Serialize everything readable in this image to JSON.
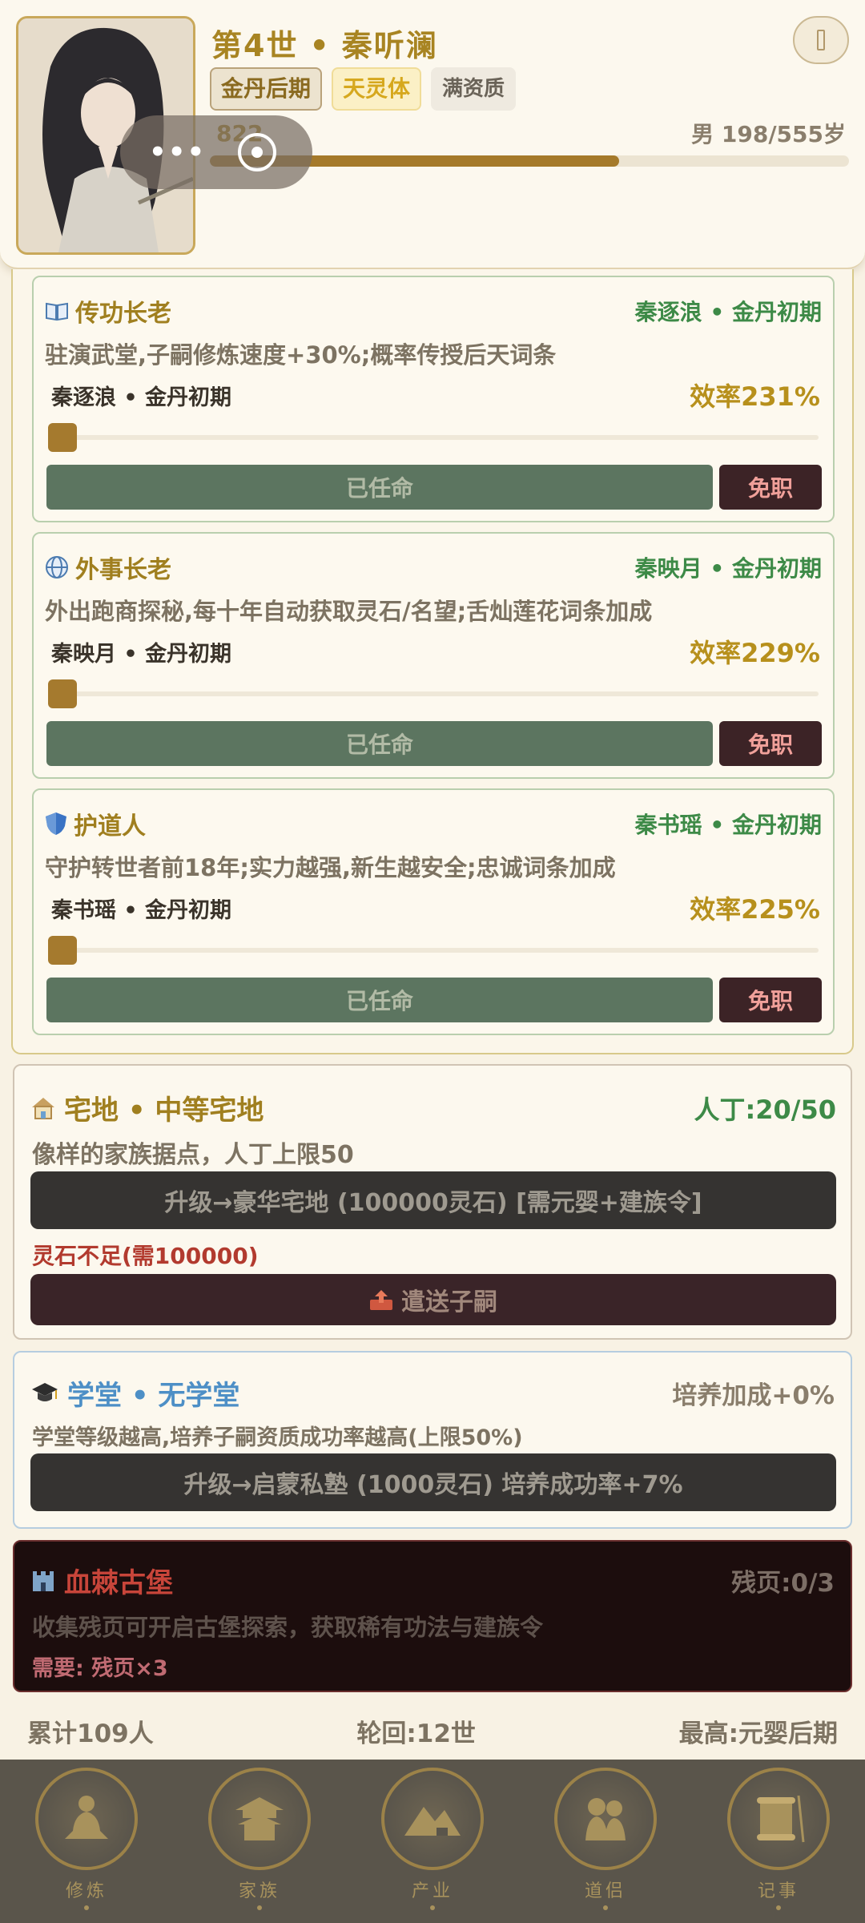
{
  "header": {
    "generation": "第4世",
    "separator": "•",
    "name": "秦听澜",
    "badges": {
      "realm": "金丹后期",
      "body": "天灵体",
      "aptitude": "满资质"
    },
    "exp_text": "822",
    "exp_progress": 0.64,
    "gender_age": "男 198/555岁"
  },
  "elders": [
    {
      "role": "传功长老",
      "icon": "book-icon",
      "holder": "秦逐浪 • 金丹初期",
      "description": "驻演武堂,子嗣修炼速度+30%;概率传授后天词条",
      "assignee": "秦逐浪 • 金丹初期",
      "efficiency": "效率231%",
      "appointed_label": "已任命",
      "dismiss_label": "免职"
    },
    {
      "role": "外事长老",
      "icon": "globe-icon",
      "holder": "秦映月 • 金丹初期",
      "description": "外出跑商探秘,每十年自动获取灵石/名望;舌灿莲花词条加成",
      "assignee": "秦映月 • 金丹初期",
      "efficiency": "效率229%",
      "appointed_label": "已任命",
      "dismiss_label": "免职"
    },
    {
      "role": "护道人",
      "icon": "shield-icon",
      "holder": "秦书瑶 • 金丹初期",
      "description": "守护转世者前18年;实力越强,新生越安全;忠诚词条加成",
      "assignee": "秦书瑶 • 金丹初期",
      "efficiency": "效率225%",
      "appointed_label": "已任命",
      "dismiss_label": "免职"
    }
  ],
  "housing": {
    "title": "宅地 • 中等宅地",
    "population": "人丁:20/50",
    "description": "像样的家族据点，人丁上限50",
    "upgrade_label": "升级→豪华宅地 (100000灵石) [需元婴+建族令]",
    "warning": "灵石不足(需100000)",
    "send_label": "遣送子嗣"
  },
  "school": {
    "title": "学堂 • 无学堂",
    "bonus": "培养加成+0%",
    "description": "学堂等级越高,培养子嗣资质成功率越高(上限50%)",
    "upgrade_label": "升级→启蒙私塾 (1000灵石) 培养成功率+7%"
  },
  "castle": {
    "title": "血棘古堡",
    "pages": "残页:0/3",
    "description": "收集残页可开启古堡探索，获取稀有功法与建族令",
    "need": "需要: 残页×3"
  },
  "stats": {
    "total": "累计109人",
    "cycles": "轮回:12世",
    "highest": "最高:元婴后期"
  },
  "nav": [
    {
      "label": "修炼",
      "icon": "meditation-icon"
    },
    {
      "label": "家族",
      "icon": "pavilion-icon"
    },
    {
      "label": "产业",
      "icon": "mountain-icon"
    },
    {
      "label": "道侣",
      "icon": "couple-icon"
    },
    {
      "label": "记事",
      "icon": "scroll-icon"
    }
  ],
  "colors": {
    "gold": "#a88422",
    "green": "#3d8a47",
    "blue": "#4d8fc6",
    "red": "#c8453a",
    "bg": "#f8f2e4"
  }
}
